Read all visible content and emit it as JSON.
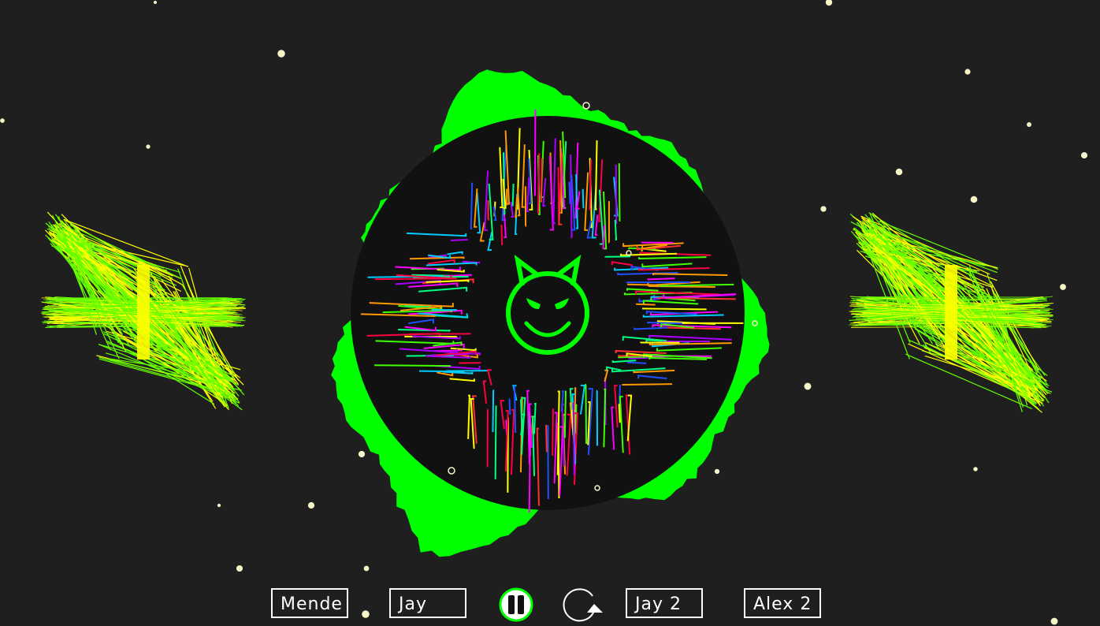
{
  "player": {
    "track_buttons": [
      {
        "label": "Mende"
      },
      {
        "label": "Jay"
      },
      {
        "label": "Jay 2"
      },
      {
        "label": "Alex 2"
      }
    ],
    "pause_icon": "pause-icon",
    "loop_icon": "loop-icon"
  },
  "theme": {
    "background": "#1f1f1f",
    "ring_color": "#00ff00",
    "disc_color": "#111111",
    "wing_color": "#66ff00",
    "wing_accent": "#ffff00",
    "star_color": "#f5f5c8",
    "control_color": "#ffffff",
    "pause_ring_color": "#00ff00"
  },
  "logo": {
    "icon": "devil-smiley-icon",
    "color": "#00ff00"
  }
}
